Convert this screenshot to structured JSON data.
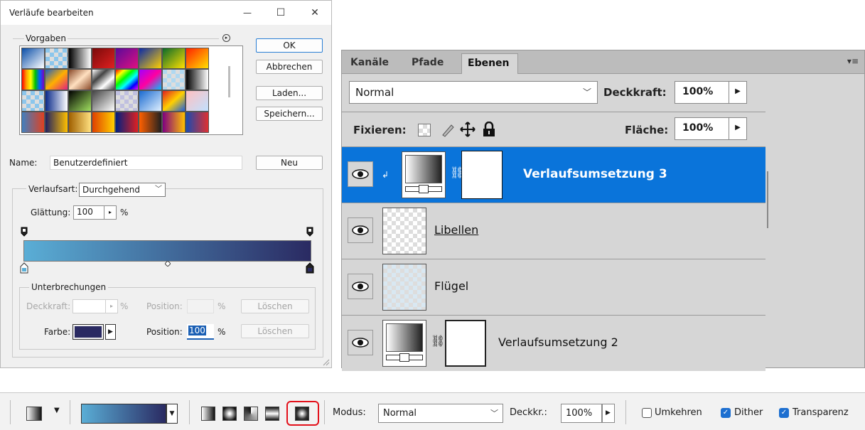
{
  "dialog": {
    "title": "Verläufe bearbeiten",
    "window_buttons": {
      "minimize": "—",
      "maximize": "☐",
      "close": "✕"
    },
    "presets_label": "Vorgaben",
    "buttons": {
      "ok": "OK",
      "cancel": "Abbrechen",
      "load": "Laden...",
      "save": "Speichern...",
      "new": "Neu"
    },
    "name_label": "Name:",
    "name_value": "Benutzerdefiniert",
    "type_label": "Verlaufsart:",
    "type_value": "Durchgehend",
    "smooth_label": "Glättung:",
    "smooth_value": "100",
    "percent": "%",
    "stops_group": "Unterbrechungen",
    "opacity_label": "Deckkraft:",
    "position_label": "Position:",
    "delete_label": "Löschen",
    "color_label": "Farbe:",
    "color_value": "#2a2a62",
    "color_position": "100",
    "gradient_colors": [
      "#5aaed6",
      "#2a2a62"
    ]
  },
  "layers_panel": {
    "tabs": [
      "Kanäle",
      "Pfade",
      "Ebenen"
    ],
    "blend_mode": "Normal",
    "opacity_label": "Deckkraft:",
    "opacity_value": "100%",
    "lock_label": "Fixieren:",
    "fill_label": "Fläche:",
    "fill_value": "100%",
    "layers": [
      {
        "name": "Verlaufsumsetzung 3",
        "selected": true
      },
      {
        "name": "Libellen",
        "selected": false
      },
      {
        "name": "Flügel",
        "selected": false
      },
      {
        "name": "Verlaufsumsetzung 2",
        "selected": false
      }
    ]
  },
  "options_bar": {
    "mode_label": "Modus:",
    "mode_value": "Normal",
    "opacity_label": "Deckkr.:",
    "opacity_value": "100%",
    "reverse_label": "Umkehren",
    "reverse_checked": false,
    "dither_label": "Dither",
    "dither_checked": true,
    "transparency_label": "Transparenz",
    "transparency_checked": true,
    "highlighted_gradient_type": "diamond"
  }
}
